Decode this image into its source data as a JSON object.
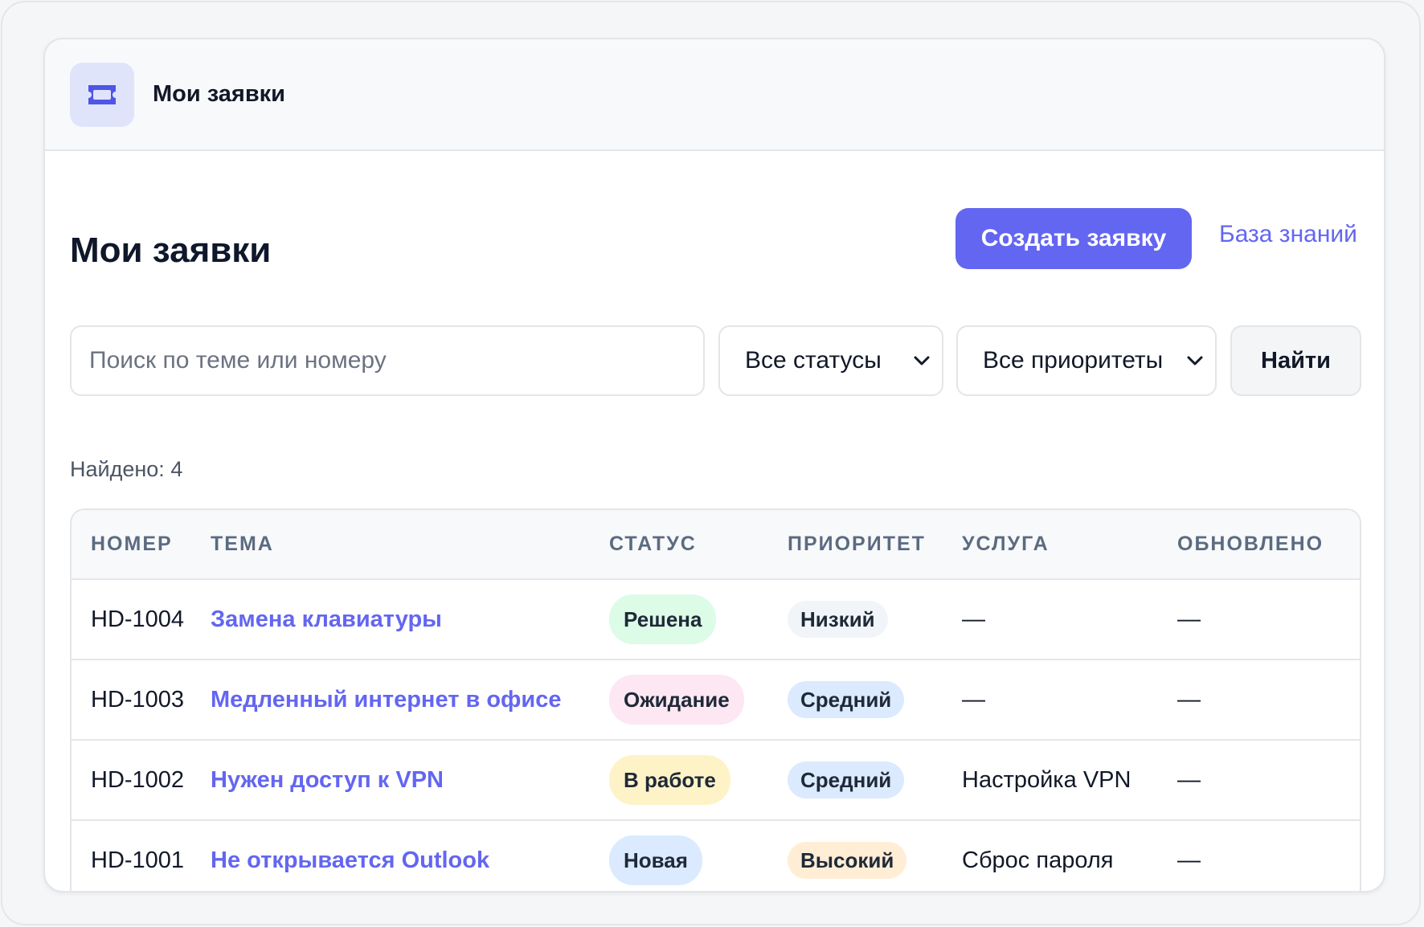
{
  "header": {
    "title": "Мои заявки",
    "icon": "ticket-icon"
  },
  "page": {
    "title": "Мои заявки"
  },
  "actions": {
    "create_label": "Создать заявку",
    "knowledge_base_label": "База знаний"
  },
  "filters": {
    "search_placeholder": "Поиск по теме или номеру",
    "search_value": "",
    "status_selected": "Все статусы",
    "priority_selected": "Все приоритеты",
    "find_label": "Найти"
  },
  "results": {
    "found_label": "Найдено:",
    "found_count": "4"
  },
  "table": {
    "columns": [
      "НОМЕР",
      "ТЕМА",
      "СТАТУС",
      "ПРИОРИТЕТ",
      "УСЛУГА",
      "ОБНОВЛЕНО"
    ],
    "rows": [
      {
        "id": "HD-1004",
        "subject": "Замена клавиатуры",
        "status": "Решена",
        "priority": "Низкий",
        "service": "—",
        "updated": "—"
      },
      {
        "id": "HD-1003",
        "subject": "Медленный интернет в офисе",
        "status": "Ожидание",
        "priority": "Средний",
        "service": "—",
        "updated": "—"
      },
      {
        "id": "HD-1002",
        "subject": "Нужен доступ к VPN",
        "status": "В работе",
        "priority": "Средний",
        "service": "Настройка VPN",
        "updated": "—"
      },
      {
        "id": "HD-1001",
        "subject": "Не открывается Outlook",
        "status": "Новая",
        "priority": "Высокий",
        "service": "Сброс пароля",
        "updated": "—"
      }
    ]
  },
  "colors": {
    "accent": "#6366f1",
    "status_resolved": "#dcfce7",
    "status_waiting": "#fce7f3",
    "status_in_progress": "#fef3c7",
    "status_new": "#dbeafe",
    "priority_low": "#f1f5f9",
    "priority_medium": "#dbeafe",
    "priority_high": "#ffedd5"
  }
}
